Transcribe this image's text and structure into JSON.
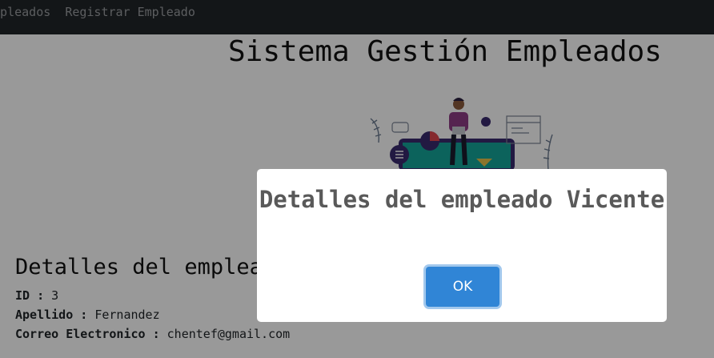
{
  "navbar": {
    "links": [
      "Empleados",
      "Registrar Empleado"
    ]
  },
  "main": {
    "title": "Sistema Gestión Empleados"
  },
  "details": {
    "heading": "Detalles del empleado",
    "fields": [
      {
        "label": "ID",
        "value": "3"
      },
      {
        "label": "Apellido",
        "value": "Fernandez"
      },
      {
        "label": "Correo Electronico",
        "value": "chentef@gmail.com"
      }
    ]
  },
  "modal": {
    "title": "Detalles del empleado Vicente",
    "ok_label": "OK"
  },
  "colors": {
    "navbar": "#212529",
    "ok_button": "#3085d6",
    "modal_title": "#595959"
  },
  "icons": [
    "illustration-person-with-laptop"
  ]
}
